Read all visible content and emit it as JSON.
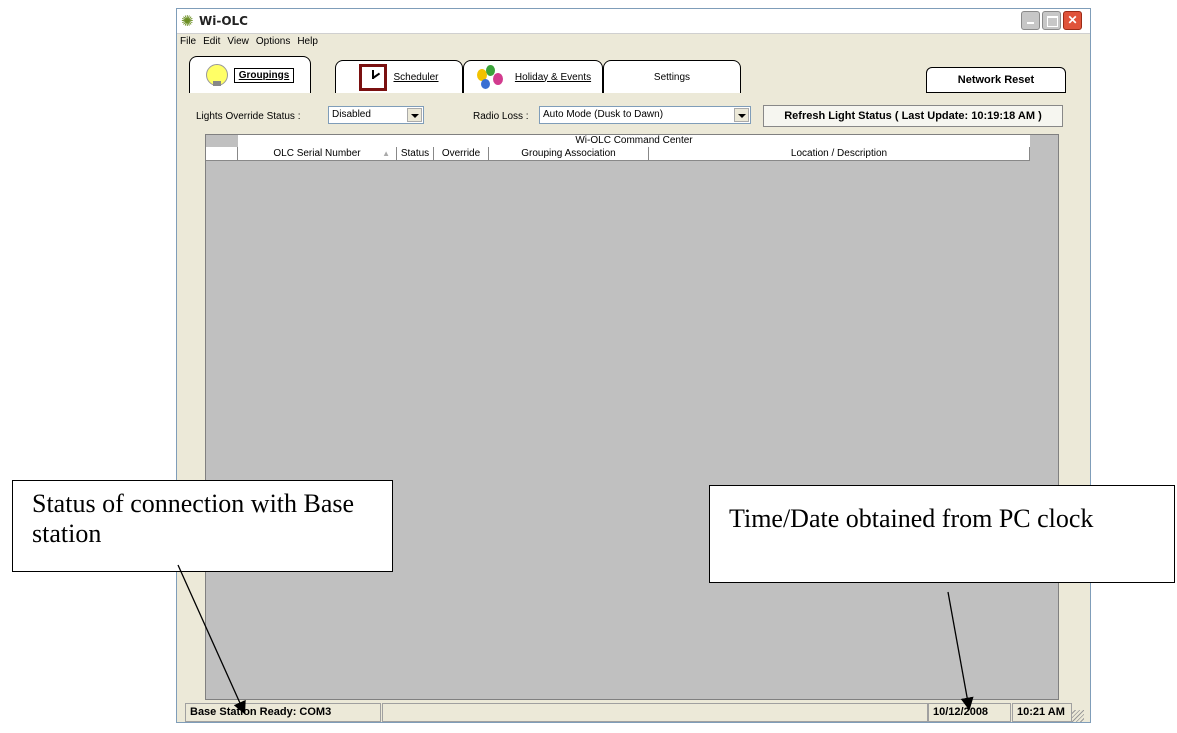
{
  "window": {
    "title": "Wi-OLC",
    "controls": [
      "minimize",
      "maximize",
      "close"
    ]
  },
  "menu": [
    "File",
    "Edit",
    "View",
    "Options",
    "Help"
  ],
  "tabs": [
    {
      "label": "Groupings",
      "icon": "lightbulb-icon",
      "active": true
    },
    {
      "label": "Scheduler",
      "icon": "clock-icon",
      "active": false
    },
    {
      "label": "Holiday & Events",
      "icon": "party-icon",
      "active": false
    },
    {
      "label": "Settings",
      "icon": "",
      "active": false
    }
  ],
  "network_reset_label": "Network Reset",
  "toolbar": {
    "override_label": "Lights Override Status :",
    "override_value": "Disabled",
    "radio_loss_label": "Radio Loss :",
    "radio_loss_value": "Auto Mode (Dusk to Dawn)",
    "refresh_label": "Refresh Light Status ( Last Update: 10:19:18 AM )"
  },
  "grid": {
    "title": "Wi-OLC Command Center",
    "columns": [
      "",
      "OLC Serial Number",
      "Status",
      "Override",
      "Grouping Association",
      "Location / Description"
    ],
    "rows": []
  },
  "statusbar": {
    "connection": "Base Station Ready: COM3",
    "date": "10/12/2008",
    "time": "10:21 AM"
  },
  "annotations": {
    "left": "Status of connection with Base station",
    "right": "Time/Date obtained from PC clock"
  },
  "colors": {
    "window_bg": "#ece9d8",
    "grid_bg": "#c0c0c0",
    "close_button": "#e0533a"
  }
}
